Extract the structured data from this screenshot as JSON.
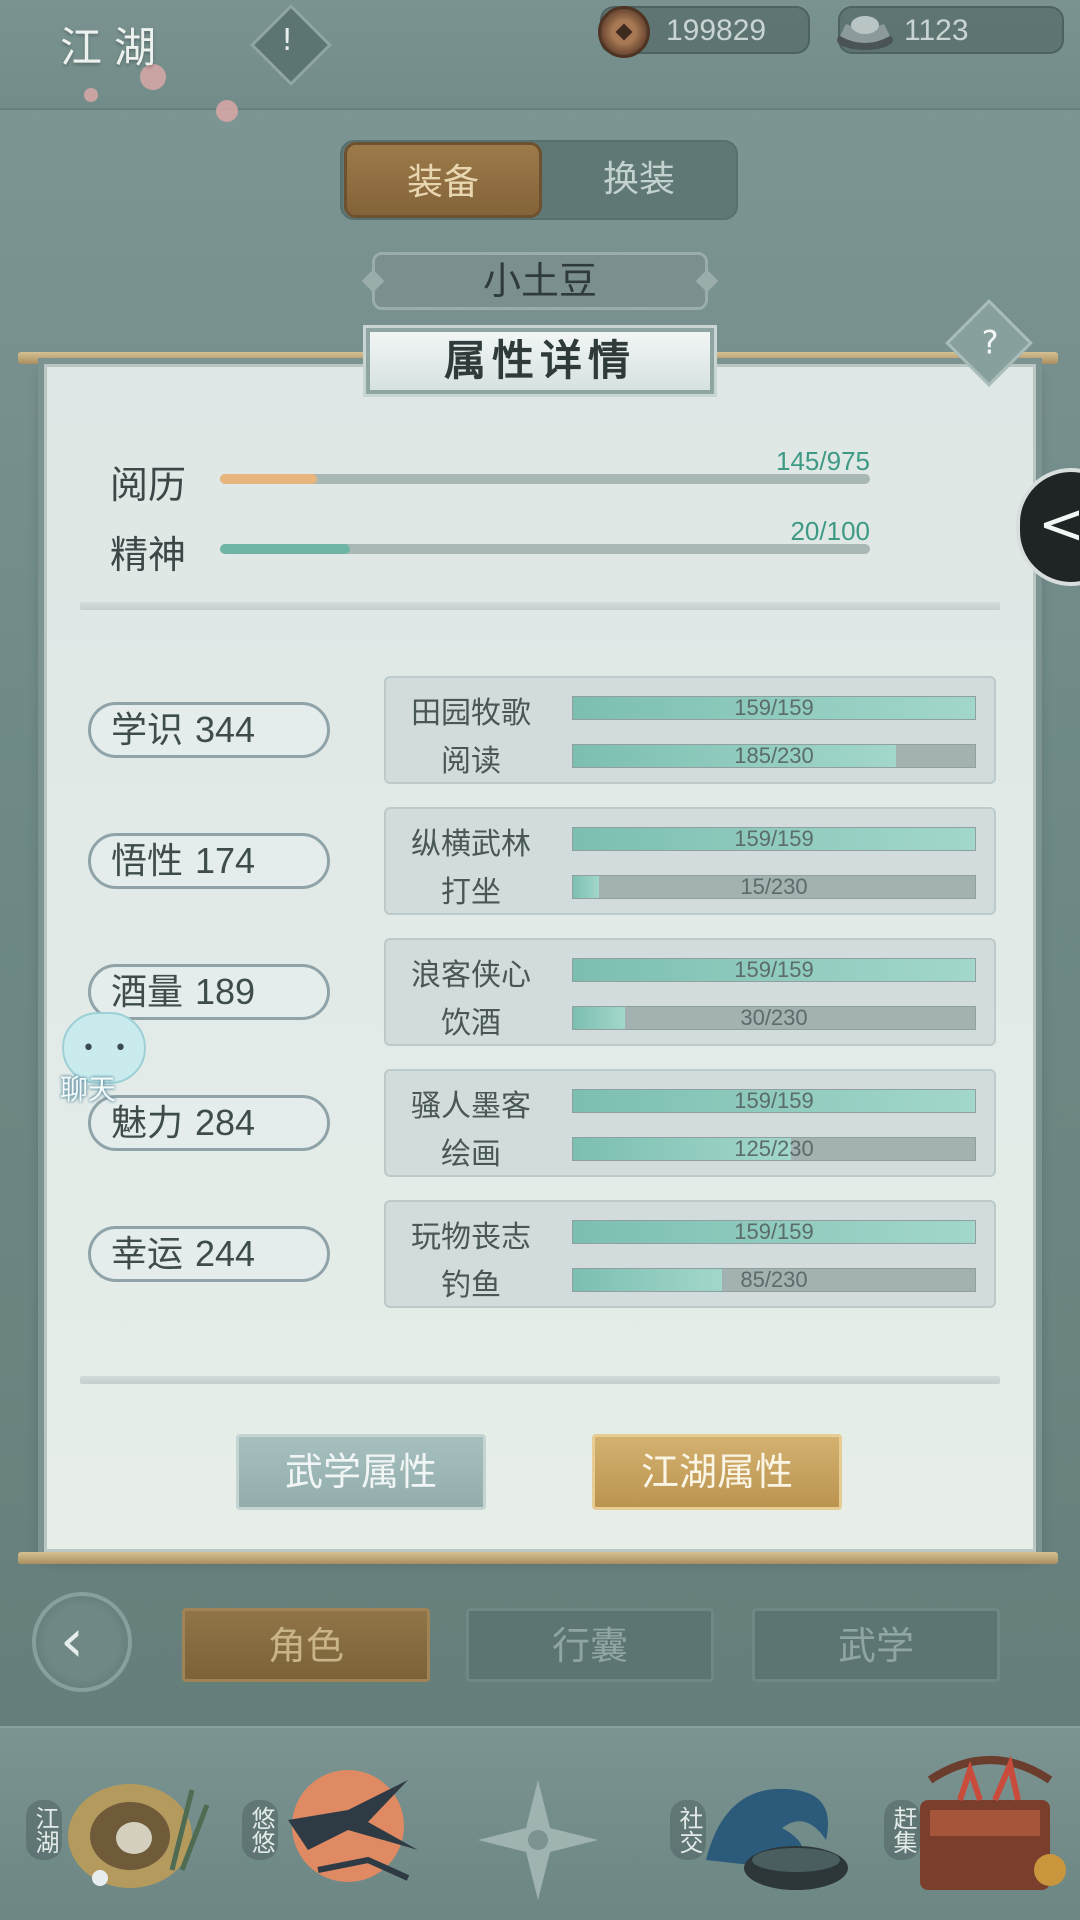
{
  "header": {
    "region_title": "江湖",
    "region_badge": "!",
    "coins": "199829",
    "silver": "1123"
  },
  "equip_tabs": {
    "equip": "装备",
    "change_outfit": "换装"
  },
  "character_name": "小土豆",
  "panel": {
    "title": "属性详情",
    "help": "?",
    "side_tab": "<",
    "top_stats": [
      {
        "label": "阅历",
        "value_text": "145/975",
        "fraction": 0.149
      },
      {
        "label": "精神",
        "value_text": "20/100",
        "fraction": 0.2
      }
    ],
    "attributes": [
      {
        "label": "学识",
        "value": "344",
        "skills": [
          {
            "name": "田园牧歌",
            "text": "159/159",
            "fraction": 1.0
          },
          {
            "name": "阅读",
            "text": "185/230",
            "fraction": 0.804
          }
        ]
      },
      {
        "label": "悟性",
        "value": "174",
        "skills": [
          {
            "name": "纵横武林",
            "text": "159/159",
            "fraction": 1.0
          },
          {
            "name": "打坐",
            "text": "15/230",
            "fraction": 0.065
          }
        ]
      },
      {
        "label": "酒量",
        "value": "189",
        "skills": [
          {
            "name": "浪客侠心",
            "text": "159/159",
            "fraction": 1.0
          },
          {
            "name": "饮酒",
            "text": "30/230",
            "fraction": 0.13
          }
        ]
      },
      {
        "label": "魅力",
        "value": "284",
        "skills": [
          {
            "name": "骚人墨客",
            "text": "159/159",
            "fraction": 1.0
          },
          {
            "name": "绘画",
            "text": "125/230",
            "fraction": 0.543
          }
        ]
      },
      {
        "label": "幸运",
        "value": "244",
        "skills": [
          {
            "name": "玩物丧志",
            "text": "159/159",
            "fraction": 1.0
          },
          {
            "name": "钓鱼",
            "text": "85/230",
            "fraction": 0.37
          }
        ]
      }
    ],
    "buttons": {
      "martial": "武学属性",
      "jianghu": "江湖属性"
    }
  },
  "chat": {
    "label": "聊天"
  },
  "nav_tabs": {
    "back": "‹",
    "role": "角色",
    "bag": "行囊",
    "martial": "武学"
  },
  "dock": [
    {
      "label": "江湖",
      "icon": "jianghu-hat-icon"
    },
    {
      "label": "悠悠",
      "icon": "swallow-moon-icon"
    },
    {
      "label": "",
      "icon": "compass-star-icon"
    },
    {
      "label": "社交",
      "icon": "wave-teacup-icon"
    },
    {
      "label": "赶集",
      "icon": "market-basket-icon"
    }
  ],
  "colors": {
    "background": "#6e8986",
    "panel": "#e3ebe8",
    "accent_gold": "#bb9450",
    "accent_teal": "#6fb5a6",
    "progress_orange": "#e8b67c"
  }
}
